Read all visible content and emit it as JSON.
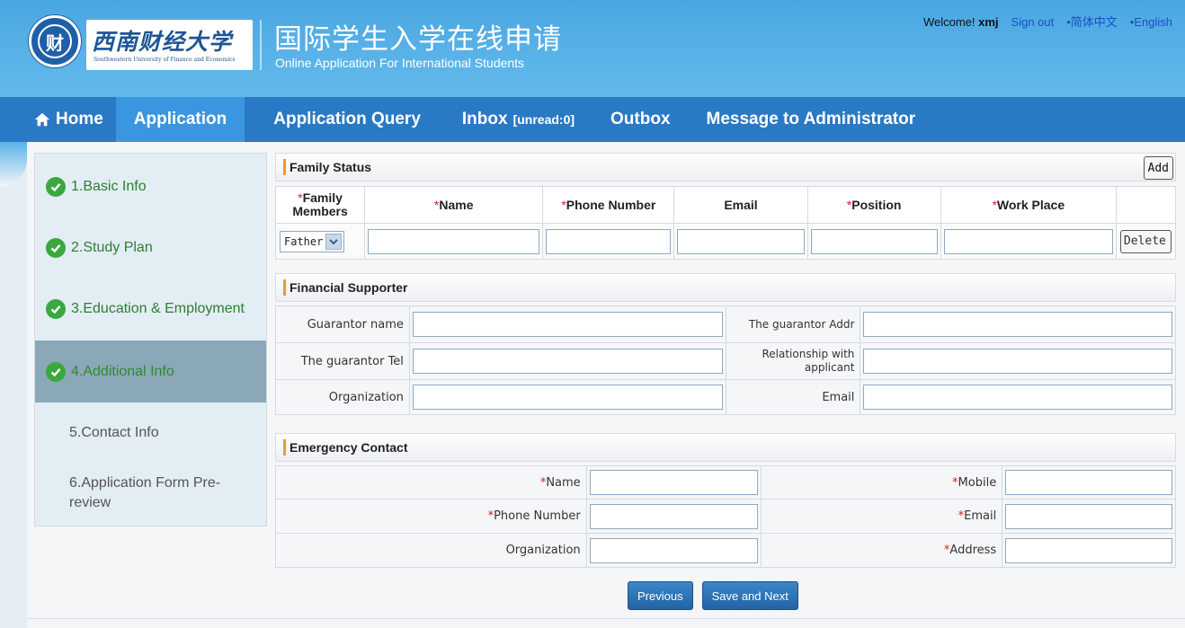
{
  "header": {
    "logo_cn": "西南财经大学",
    "logo_en": "Southwestern University of Finance and Economics",
    "title_cn": "国际学生入学在线申请",
    "title_en": "Online Application For International Students",
    "welcome_prefix": "Welcome!",
    "username": "xmj",
    "sign_out": "Sign out",
    "lang_cn": "•简体中文",
    "lang_en": "•English"
  },
  "nav": {
    "home": "Home",
    "application": "Application",
    "query": "Application Query",
    "inbox": "Inbox",
    "inbox_unread": "[unread:0]",
    "outbox": "Outbox",
    "message": "Message to Administrator"
  },
  "sidebar": {
    "items": [
      {
        "label": "1.Basic Info",
        "done": true
      },
      {
        "label": "2.Study Plan",
        "done": true
      },
      {
        "label": "3.Education & Employment",
        "done": true
      },
      {
        "label": "4.Additional Info",
        "done": true,
        "active": true
      },
      {
        "label": "5.Contact Info",
        "done": false
      },
      {
        "label": "6.Application Form Pre-review",
        "done": false
      }
    ]
  },
  "family": {
    "title": "Family Status",
    "add_label": "Add",
    "columns": [
      "Family Members",
      "Name",
      "Phone Number",
      "Email",
      "Position",
      "Work Place"
    ],
    "row": {
      "member": "Father",
      "delete_label": "Delete"
    }
  },
  "financial": {
    "title": "Financial Supporter",
    "guarantor_name": "Guarantor name",
    "guarantor_addr": "The guarantor Addr",
    "guarantor_tel": "The guarantor Tel",
    "relationship": "Relationship with applicant",
    "organization": "Organization",
    "email": "Email"
  },
  "emergency": {
    "title": "Emergency Contact",
    "name": "Name",
    "mobile": "Mobile",
    "phone": "Phone Number",
    "email": "Email",
    "organization": "Organization",
    "address": "Address"
  },
  "buttons": {
    "previous": "Previous",
    "save_next": "Save and Next"
  },
  "colors": {
    "header_bg": "#5ab3e8",
    "nav_bg": "#2a79c4",
    "nav_active": "#3a96e0",
    "check_green": "#3aa83e",
    "required_red": "#d62020",
    "section_bar": "#f09a28"
  }
}
